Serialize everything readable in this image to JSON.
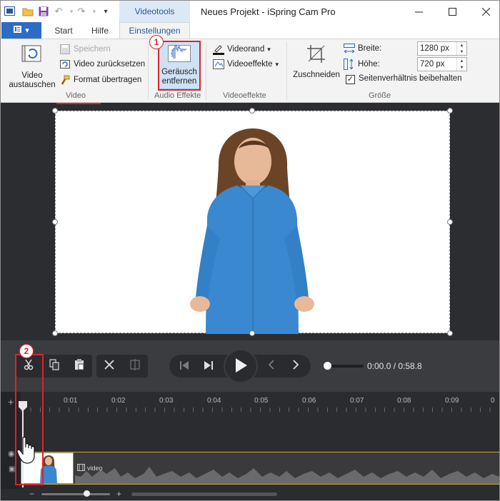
{
  "window": {
    "title": "Neues Projekt - iSpring Cam Pro",
    "context_tab": "Videotools"
  },
  "tabs": {
    "start": "Start",
    "help": "Hilfe",
    "settings": "Einstellungen"
  },
  "ribbon": {
    "replace_video": "Video austauschen",
    "save": "Speichern",
    "reset_video": "Video zurücksetzen",
    "format_painter": "Format übertragen",
    "group_video": "Video",
    "remove_noise_line1": "Geräusch",
    "remove_noise_line2": "entfernen",
    "group_audio": "Audio Effekte",
    "video_border": "Videorand",
    "video_effects": "Videoeffekte",
    "group_video_effects": "Videoeffekte",
    "crop": "Zuschneiden",
    "width_label": "Breite:",
    "width_value": "1280 px",
    "height_label": "Höhe:",
    "height_value": "720 px",
    "keep_aspect": "Seitenverhältnis beibehalten",
    "group_size": "Größe"
  },
  "player": {
    "time": "0:00.0 / 0:58.8"
  },
  "timeline": {
    "ticks": [
      "0:01",
      "0:02",
      "0:03",
      "0:04",
      "0:05",
      "0:06",
      "0:07",
      "0:08",
      "0:09"
    ],
    "track_label": "video"
  },
  "annotations": {
    "step1": "1",
    "step2": "2"
  },
  "colors": {
    "accent": "#2b579a",
    "highlight": "#d9252a",
    "track_border": "#c9a64a"
  }
}
